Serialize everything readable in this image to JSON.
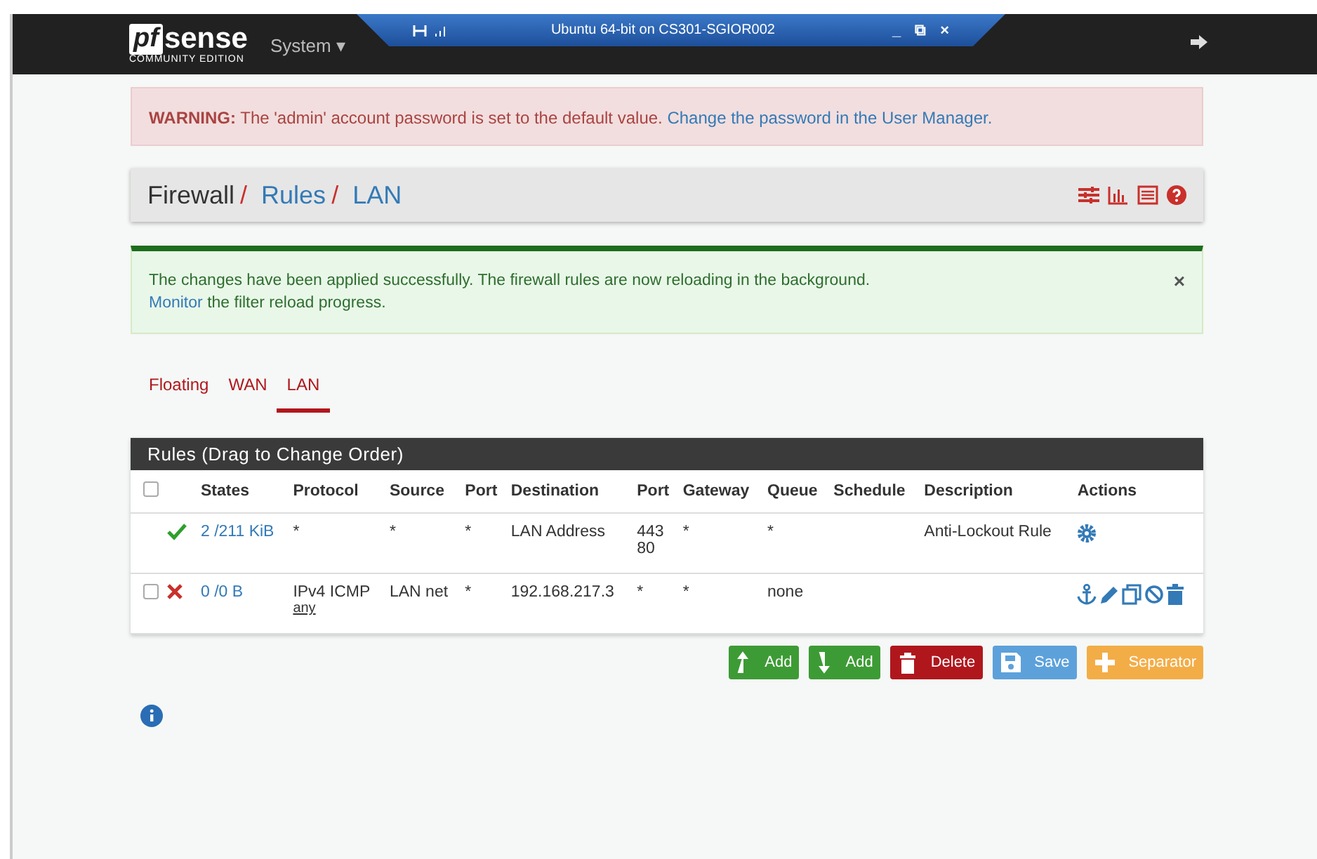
{
  "vm_bar": {
    "title": "Ubuntu 64-bit on CS301-SGIOR002",
    "buttons": [
      "_",
      "⧉",
      "×"
    ]
  },
  "navbar": {
    "logo_main": "sense",
    "logo_mark": "pf",
    "logo_sub": "COMMUNITY EDITION",
    "menus": [
      {
        "label": "System",
        "caret": "▾"
      }
    ]
  },
  "warning": {
    "strong": "WARNING:",
    "text": "The 'admin' account password is set to the default value.",
    "link": "Change the password in the User Manager."
  },
  "breadcrumb": [
    {
      "label": "Firewall",
      "link": false
    },
    {
      "label": "Rules",
      "link": true
    },
    {
      "label": "LAN",
      "link": true
    }
  ],
  "breadcrumb_sep": "/",
  "alert": {
    "text": "The changes have been applied successfully. The firewall rules are now reloading in the background.",
    "link": "Monitor",
    "rest": "the filter reload progress.",
    "close": "×"
  },
  "tabs": [
    {
      "label": "Floating",
      "selected": false
    },
    {
      "label": "WAN",
      "selected": false
    },
    {
      "label": "LAN",
      "selected": true
    }
  ],
  "table": {
    "title": "Rules (Drag to Change Order)",
    "select_all_checked": false,
    "columns": [
      "States",
      "Protocol",
      "Source",
      "Port",
      "Destination",
      "Port",
      "Gateway",
      "Queue",
      "Schedule",
      "Description",
      "Actions"
    ],
    "rows": [
      {
        "checkbox": false,
        "pass": true,
        "states": "2 /211 KiB",
        "protocol": "*",
        "source": "*",
        "source_port": "*",
        "destination": "LAN Address",
        "dest_port": [
          "443",
          "80"
        ],
        "gateway": "*",
        "queue": "*",
        "description": "Anti-Lockout Rule",
        "editable": false
      },
      {
        "checkbox": true,
        "checked": false,
        "pass": false,
        "states": "0 /0 B",
        "protocol": "IPv4 ICMP",
        "protocol_sub": "any",
        "source": "LAN net",
        "source_port": "*",
        "destination": "192.168.217.3",
        "dest_port": [
          "*"
        ],
        "gateway": "*",
        "queue": "none",
        "editable": true
      }
    ]
  },
  "buttons": [
    {
      "kind": "add-up",
      "label": "Add",
      "color": "#3d9b35"
    },
    {
      "kind": "add-down",
      "label": "Add",
      "color": "#3d9b35"
    },
    {
      "kind": "delete",
      "label": "Delete",
      "color": "#b0171d"
    },
    {
      "kind": "save",
      "label": "Save",
      "color": "#5da1db"
    },
    {
      "kind": "separator",
      "label": "Separator",
      "color": "#f3ad47"
    }
  ]
}
